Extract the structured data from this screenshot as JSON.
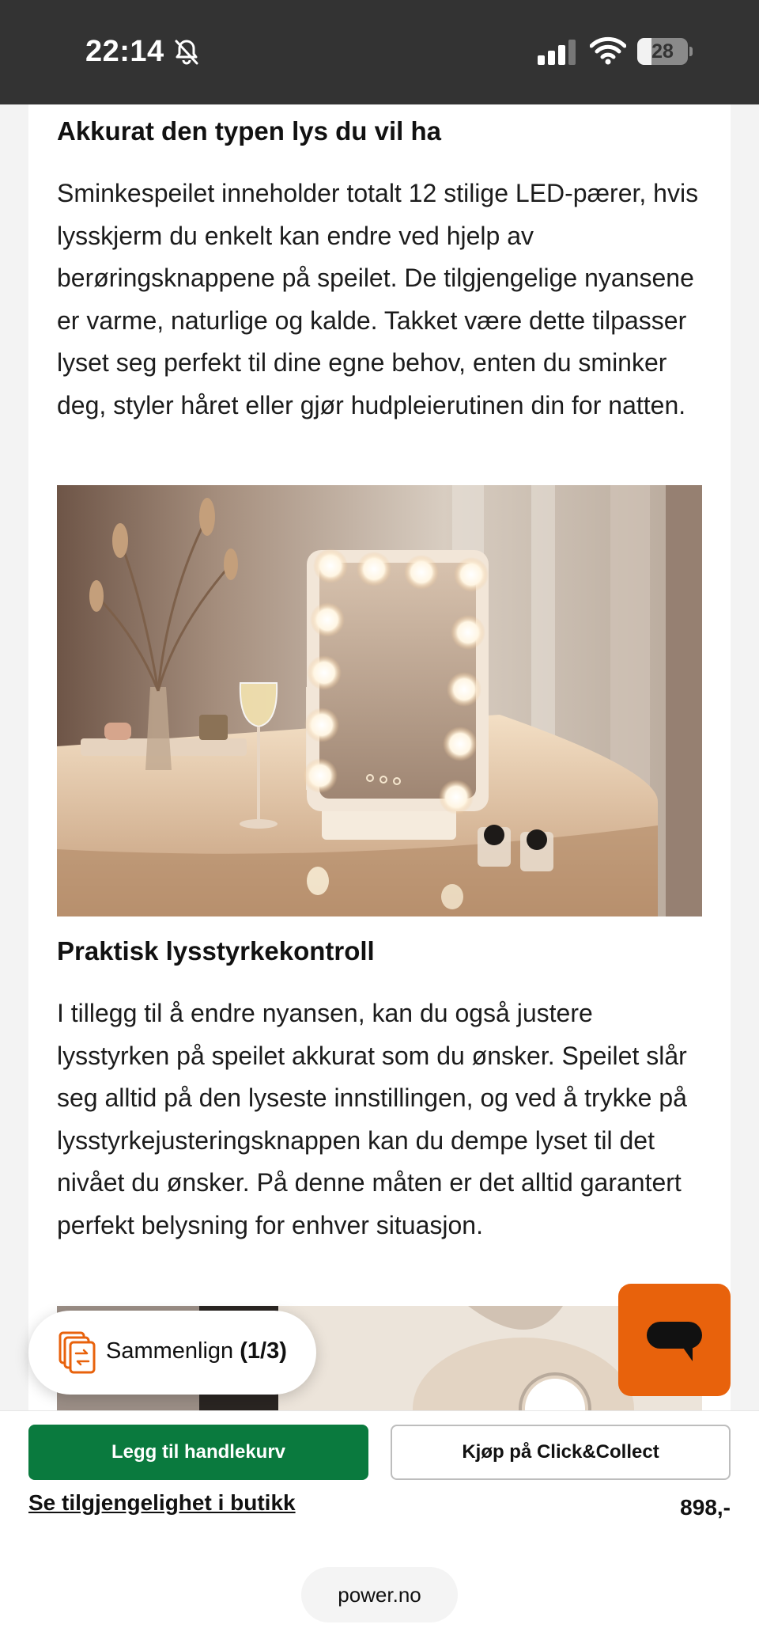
{
  "status_bar": {
    "time": "22:14",
    "battery_level": "28",
    "battery_fraction": 0.28,
    "icons": [
      "bell-slash-icon",
      "signal-icon",
      "wifi-icon",
      "battery-icon"
    ]
  },
  "article": {
    "sections": [
      {
        "heading": "Akkurat den typen lys du vil ha",
        "body": "Sminkespeilet inneholder totalt 12 stilige LED-pærer, hvis lysskjerm du enkelt kan endre ved hjelp av berøringsknappene på speilet. De tilgjengelige nyansene er varme, naturlige og kalde. Takket være dette tilpasser lyset seg perfekt til dine egne behov, enten du sminker deg, styler håret eller gjør hudpleierutinen din for natten."
      },
      {
        "heading": "Praktisk lysstyrkekontroll",
        "body": "I tillegg til å endre nyansen, kan du også justere lysstyrken på speilet akkurat som du ønsker. Speilet slår seg alltid på den lyseste innstillingen, og ved å trykke på lysstyrkejusteringsknappen kan du dempe lyset til det nivået du ønsker. På denne måten er det alltid garantert perfekt belysning for enhver situasjon."
      }
    ]
  },
  "compare": {
    "label": "Sammenlign",
    "count": "(1/3)"
  },
  "actions": {
    "add_to_cart": "Legg til handlekurv",
    "click_collect": "Kjøp på Click&Collect",
    "availability": "Se tilgjengelighet i butikk",
    "price": "898,-"
  },
  "browser": {
    "url": "power.no"
  },
  "colors": {
    "status_bar_bg": "#333333",
    "primary_green": "#0a7a3e",
    "chat_orange": "#e8620c",
    "compare_icon_orange": "#e8620c"
  }
}
